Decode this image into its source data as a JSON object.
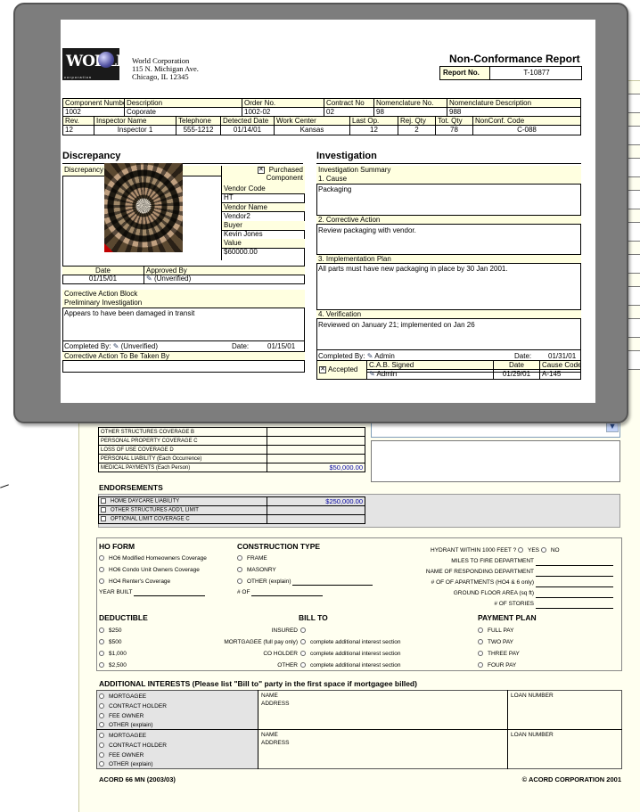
{
  "acord": {
    "coverage_rows": [
      {
        "label": "OTHER STRUCTURES COVERAGE B",
        "value": ""
      },
      {
        "label": "PERSONAL PROPERTY COVERAGE C",
        "value": ""
      },
      {
        "label": "LOSS OF USE COVERAGE D",
        "value": ""
      },
      {
        "label": "PERSONAL LIABILITY (Each Occurrence)",
        "value": ""
      },
      {
        "label": "MEDICAL PAYMENTS (Each Person)",
        "value": "$50,000.00"
      }
    ],
    "endorsements_title": "ENDORSEMENTS",
    "endorsements": [
      {
        "label": "HOME DAYCARE LIABILITY",
        "value": "$250,000.00"
      },
      {
        "label": "OTHER STRUCTURES ADD'L LIMIT",
        "value": ""
      },
      {
        "label": "OPTIONAL LIMIT COVERAGE C",
        "value": ""
      }
    ],
    "ho_form_title": "HO FORM",
    "ho_forms": [
      "HO6 Modified Homeowners Coverage",
      "HO6 Condo Unit Owners Coverage",
      "HO4 Renter's Coverage"
    ],
    "year_built": "YEAR BUILT",
    "construction_title": "CONSTRUCTION TYPE",
    "construction": [
      "FRAME",
      "MASONRY",
      "OTHER (explain)"
    ],
    "num_of": "# OF",
    "hydrant": "HYDRANT WITHIN 1000 FEET ?",
    "yes": "YES",
    "no": "NO",
    "right_fields": [
      "MILES TO FIRE DEPARTMENT",
      "NAME OF RESPONDING DEPARTMENT",
      "# OF OF APARTMENTS (HO4 & 6 only)",
      "GROUND FLOOR AREA (sq ft)",
      "# OF STORIES"
    ],
    "deductible_title": "DEDUCTIBLE",
    "deductibles": [
      "$250",
      "$500",
      "$1,000",
      "$2,500"
    ],
    "billto_title": "BILL TO",
    "billto": [
      {
        "label": "INSURED",
        "note": ""
      },
      {
        "label": "MORTGAGEE (full pay only)",
        "note": "complete additional interest section"
      },
      {
        "label": "CO HOLDER",
        "note": "complete additional interest section"
      },
      {
        "label": "OTHER",
        "note": "complete additional interest section"
      }
    ],
    "payment_title": "PAYMENT PLAN",
    "payments": [
      "FULL PAY",
      "TWO PAY",
      "THREE PAY",
      "FOUR PAY"
    ],
    "ai_title": "ADDITIONAL INTERESTS (Please list \"Bill to\" party in the first space if mortgagee billed)",
    "ai_types": [
      "MORTGAGEE",
      "CONTRACT HOLDER",
      "FEE OWNER",
      "OTHER (explain)"
    ],
    "name": "NAME",
    "address": "ADDRESS",
    "loan": "LOAN NUMBER",
    "footer_left": "ACORD 66 MN (2003/03)",
    "footer_right": "© ACORD CORPORATION 2001"
  },
  "report": {
    "logo": "WORLD",
    "logo_sub": "corporation",
    "company": [
      "World Corporation",
      "115 N. Michigan Ave.",
      "Chicago, IL 12345"
    ],
    "title": "Non-Conformance Report",
    "report_no_label": "Report No.",
    "report_no": "T-10877",
    "row1_headers": [
      "Component Number",
      "Description",
      "Order No.",
      "Contract No",
      "Nomenclature No.",
      "Nomenclature Description"
    ],
    "row1_values": [
      "1002",
      "Coporate",
      "1002-02",
      "02",
      "98",
      "988"
    ],
    "row2_headers": [
      "Rev.",
      "Inspector Name",
      "Telephone",
      "Detected Date",
      "Work Center",
      "Last Op.",
      "Rej. Qty",
      "Tot. Qty",
      "NonConf. Code"
    ],
    "row2_values": [
      "12",
      "Inspector 1",
      "555-1212",
      "01/14/01",
      "Kansas",
      "12",
      "2",
      "78",
      "C-088"
    ],
    "discrepancy_title": "Discrepancy",
    "discrepancy_label": "Discrepancy",
    "purchased": "Purchased Component",
    "vendor_code_label": "Vendor Code",
    "vendor_code": "HT",
    "vendor_name_label": "Vendor Name",
    "vendor_name": "Vendor2",
    "buyer_label": "Buyer",
    "buyer": "Kevin Jones",
    "value_label": "Value",
    "value": "$60000.00",
    "date_label": "Date",
    "approved_label": "Approved By",
    "date": "01/15/01",
    "approved": "(Unverified)",
    "cab_title": "Corrective Action Block",
    "prelim_label": "Preliminary Investigation",
    "prelim_text": "Appears to have been damaged in transit",
    "completed_label": "Completed By:",
    "completed_by": "(Unverified)",
    "date_colon": "Date:",
    "completed_date": "01/15/01",
    "cat_label": "Corrective Action To Be Taken By",
    "investigation_title": "Investigation",
    "inv_summary": "Investigation Summary",
    "cause_label": "1. Cause",
    "cause": "Packaging",
    "ca_label": "2. Corrective Action",
    "ca": "Review packaging with vendor.",
    "plan_label": "3. Implementation Plan",
    "plan": "All parts must have new packaging in place by 30 Jan 2001.",
    "verif_label": "4. Verification",
    "verif": "Reviewed on January 21; implemented on Jan 26",
    "inv_completed_by": "Admin",
    "inv_date": "01/31/01",
    "accepted": "Accepted",
    "cab_signed_label": "C.A.B. Signed",
    "cab_signed": "Admin",
    "date_h": "Date",
    "cause_code_label": "Cause Code",
    "sign_date": "01/29/01",
    "cause_code": "A-145"
  }
}
